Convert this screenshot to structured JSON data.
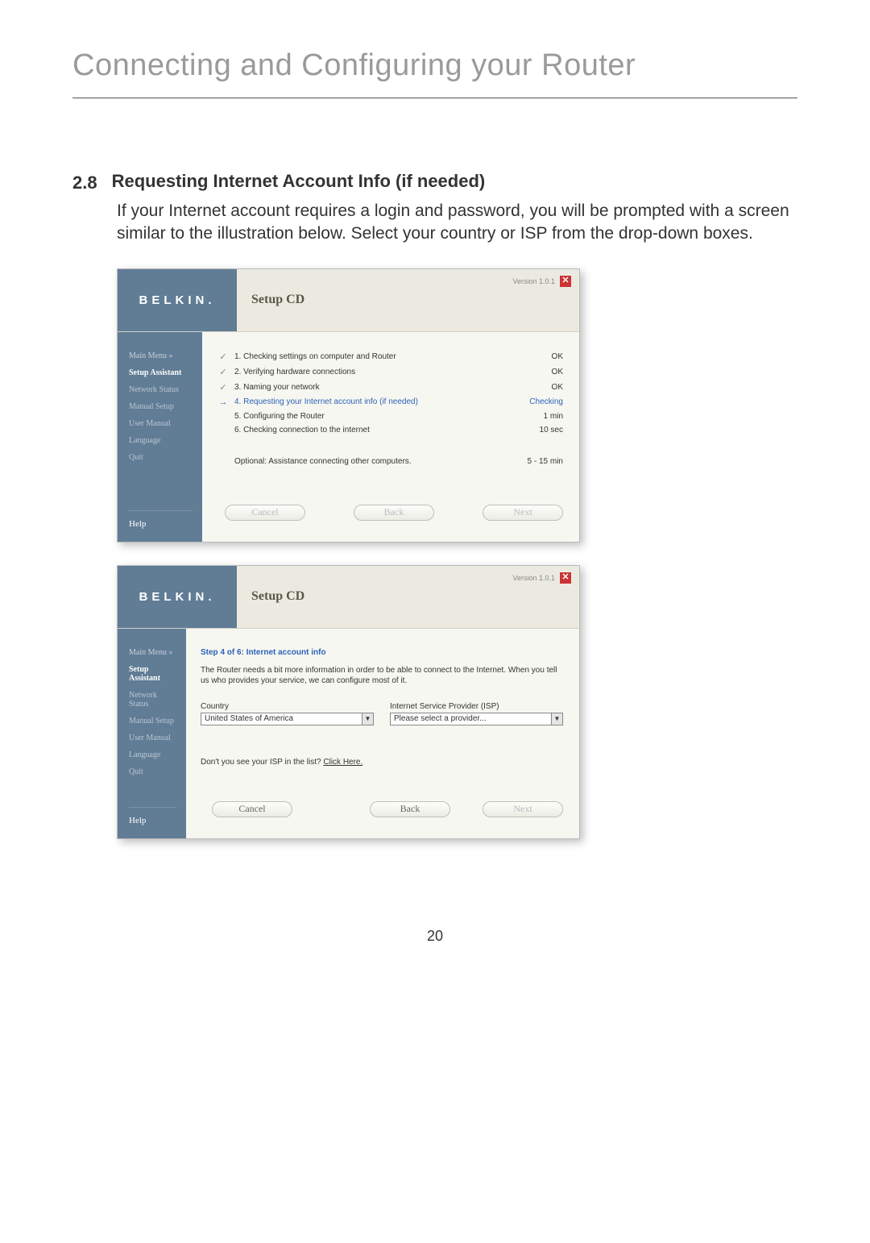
{
  "page": {
    "title": "Connecting and Configuring your Router",
    "section_number": "2.8",
    "section_heading": "Requesting Internet Account Info (if needed)",
    "section_body": "If your Internet account requires a login and password, you will be prompted with a screen similar to the illustration below. Select your country or ISP from the drop-down boxes.",
    "page_number": "20"
  },
  "logo_text": "BELKIN.",
  "setup_cd_title": "Setup CD",
  "version_text": "Version 1.0.1",
  "close_glyph": "✕",
  "sidebar": {
    "main": "Main Menu  »",
    "items": [
      "Setup Assistant",
      "Network Status",
      "Manual Setup",
      "User Manual",
      "Language",
      "Quit"
    ],
    "help": "Help"
  },
  "window1": {
    "steps": [
      {
        "icon": "check",
        "label": "1. Checking settings on computer and Router",
        "status": "OK"
      },
      {
        "icon": "check",
        "label": "2. Verifying hardware connections",
        "status": "OK"
      },
      {
        "icon": "check",
        "label": "3. Naming your network",
        "status": "OK"
      },
      {
        "icon": "arrow",
        "label": "4. Requesting your Internet account info (if needed)",
        "status": "Checking",
        "current": true
      },
      {
        "icon": "",
        "label": "5. Configuring the Router",
        "status": "1 min"
      },
      {
        "icon": "",
        "label": "6. Checking connection to the internet",
        "status": "10 sec"
      }
    ],
    "optional_label": "Optional: Assistance connecting other computers.",
    "optional_time": "5 - 15 min",
    "buttons": {
      "cancel": "Cancel",
      "back": "Back",
      "next": "Next"
    }
  },
  "window2": {
    "step_header": "Step 4 of 6: Internet account info",
    "step_desc": "The Router needs a bit more information in order to be able to connect to the Internet. When you tell us who provides your service, we can configure most of it.",
    "country_label": "Country",
    "country_value": "United States of America",
    "isp_label": "Internet Service Provider (ISP)",
    "isp_value": "Please select a provider...",
    "note_prefix": "Don't you see your ISP in the list? ",
    "note_link": "Click Here.",
    "buttons": {
      "cancel": "Cancel",
      "back": "Back",
      "next": "Next"
    }
  }
}
